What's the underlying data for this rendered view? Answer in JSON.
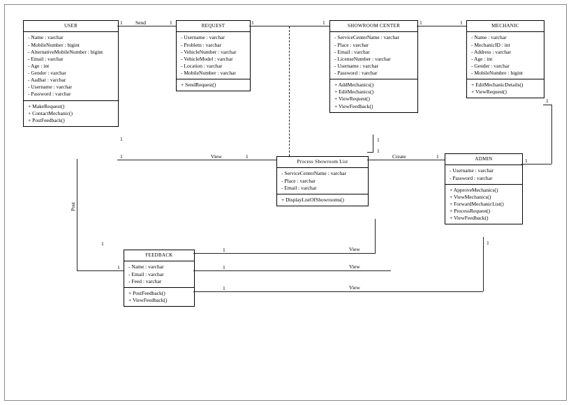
{
  "classes": {
    "user": {
      "title": "USER",
      "attrs": [
        "- Name : varchar",
        "- MobileNumber : bigint",
        "- AlternativeMobileNumber : bigint",
        "- Email : varchar",
        "- Age : int",
        "- Gender : varchar",
        "- Aadhar : varchar",
        "- Username : varchar",
        "- Password : varchar"
      ],
      "ops": [
        "+ MakeRequest()",
        "+ ContactMechanic()",
        "+ PostFeedback()"
      ]
    },
    "request": {
      "title": "REQUEST",
      "attrs": [
        "- Username : varchar",
        "- Problem : varchar",
        "- VehicleNumber : varchar",
        "- VehicleModel : varchar",
        "- Location : varchar",
        "- MobileNumber : varchar"
      ],
      "ops": [
        "+ SendRequest()"
      ]
    },
    "showroom": {
      "title": "SHOWROOM CENTER",
      "attrs": [
        "- ServiceCenterName : varchar",
        "- Place : varchar",
        "- Email : varchar",
        "- LicenseNumber : varchar",
        "- Username : varchar",
        "- Password : varchar"
      ],
      "ops": [
        "+ AddMechanics()",
        "+ EditMechanics()",
        "+ ViewRequest()",
        "+ ViewFeedback()"
      ]
    },
    "mechanic": {
      "title": "MECHANIC",
      "attrs": [
        "- Name : varchar",
        "- MechanicID : int",
        "- Address : varchar",
        "- Age : int",
        "- Gender : varchar",
        "- MobileNumbre : bigint"
      ],
      "ops": [
        "+ EditMechanicDetails()",
        "+ ViewRequest()"
      ]
    },
    "psl": {
      "title": "Process Showroom List",
      "attrs": [
        "- ServiceCenterName : varchar",
        "- Place : varchar",
        "- Email : varchar"
      ],
      "ops": [
        "+ DisplayListOfShowrooms()"
      ]
    },
    "admin": {
      "title": "ADMIN",
      "attrs": [
        "- Username : varchar",
        "- Password : varchar"
      ],
      "ops": [
        "+ ApproveMechanics()",
        "+ ViewMechanics()",
        "+ ForwardMechanicList()",
        "+ ProcessRequest()",
        "+ ViewFeedback()"
      ]
    },
    "feedback": {
      "title": "FEEDBACK",
      "attrs": [
        "- Name : varchar",
        "- Email : varchar",
        "- Feed : varchar"
      ],
      "ops": [
        "+ PostFeedback()",
        "+ ViewFeedback()"
      ]
    }
  },
  "labels": {
    "send": "Send",
    "view": "View",
    "post": "Post",
    "create": "Create",
    "one": "1"
  }
}
